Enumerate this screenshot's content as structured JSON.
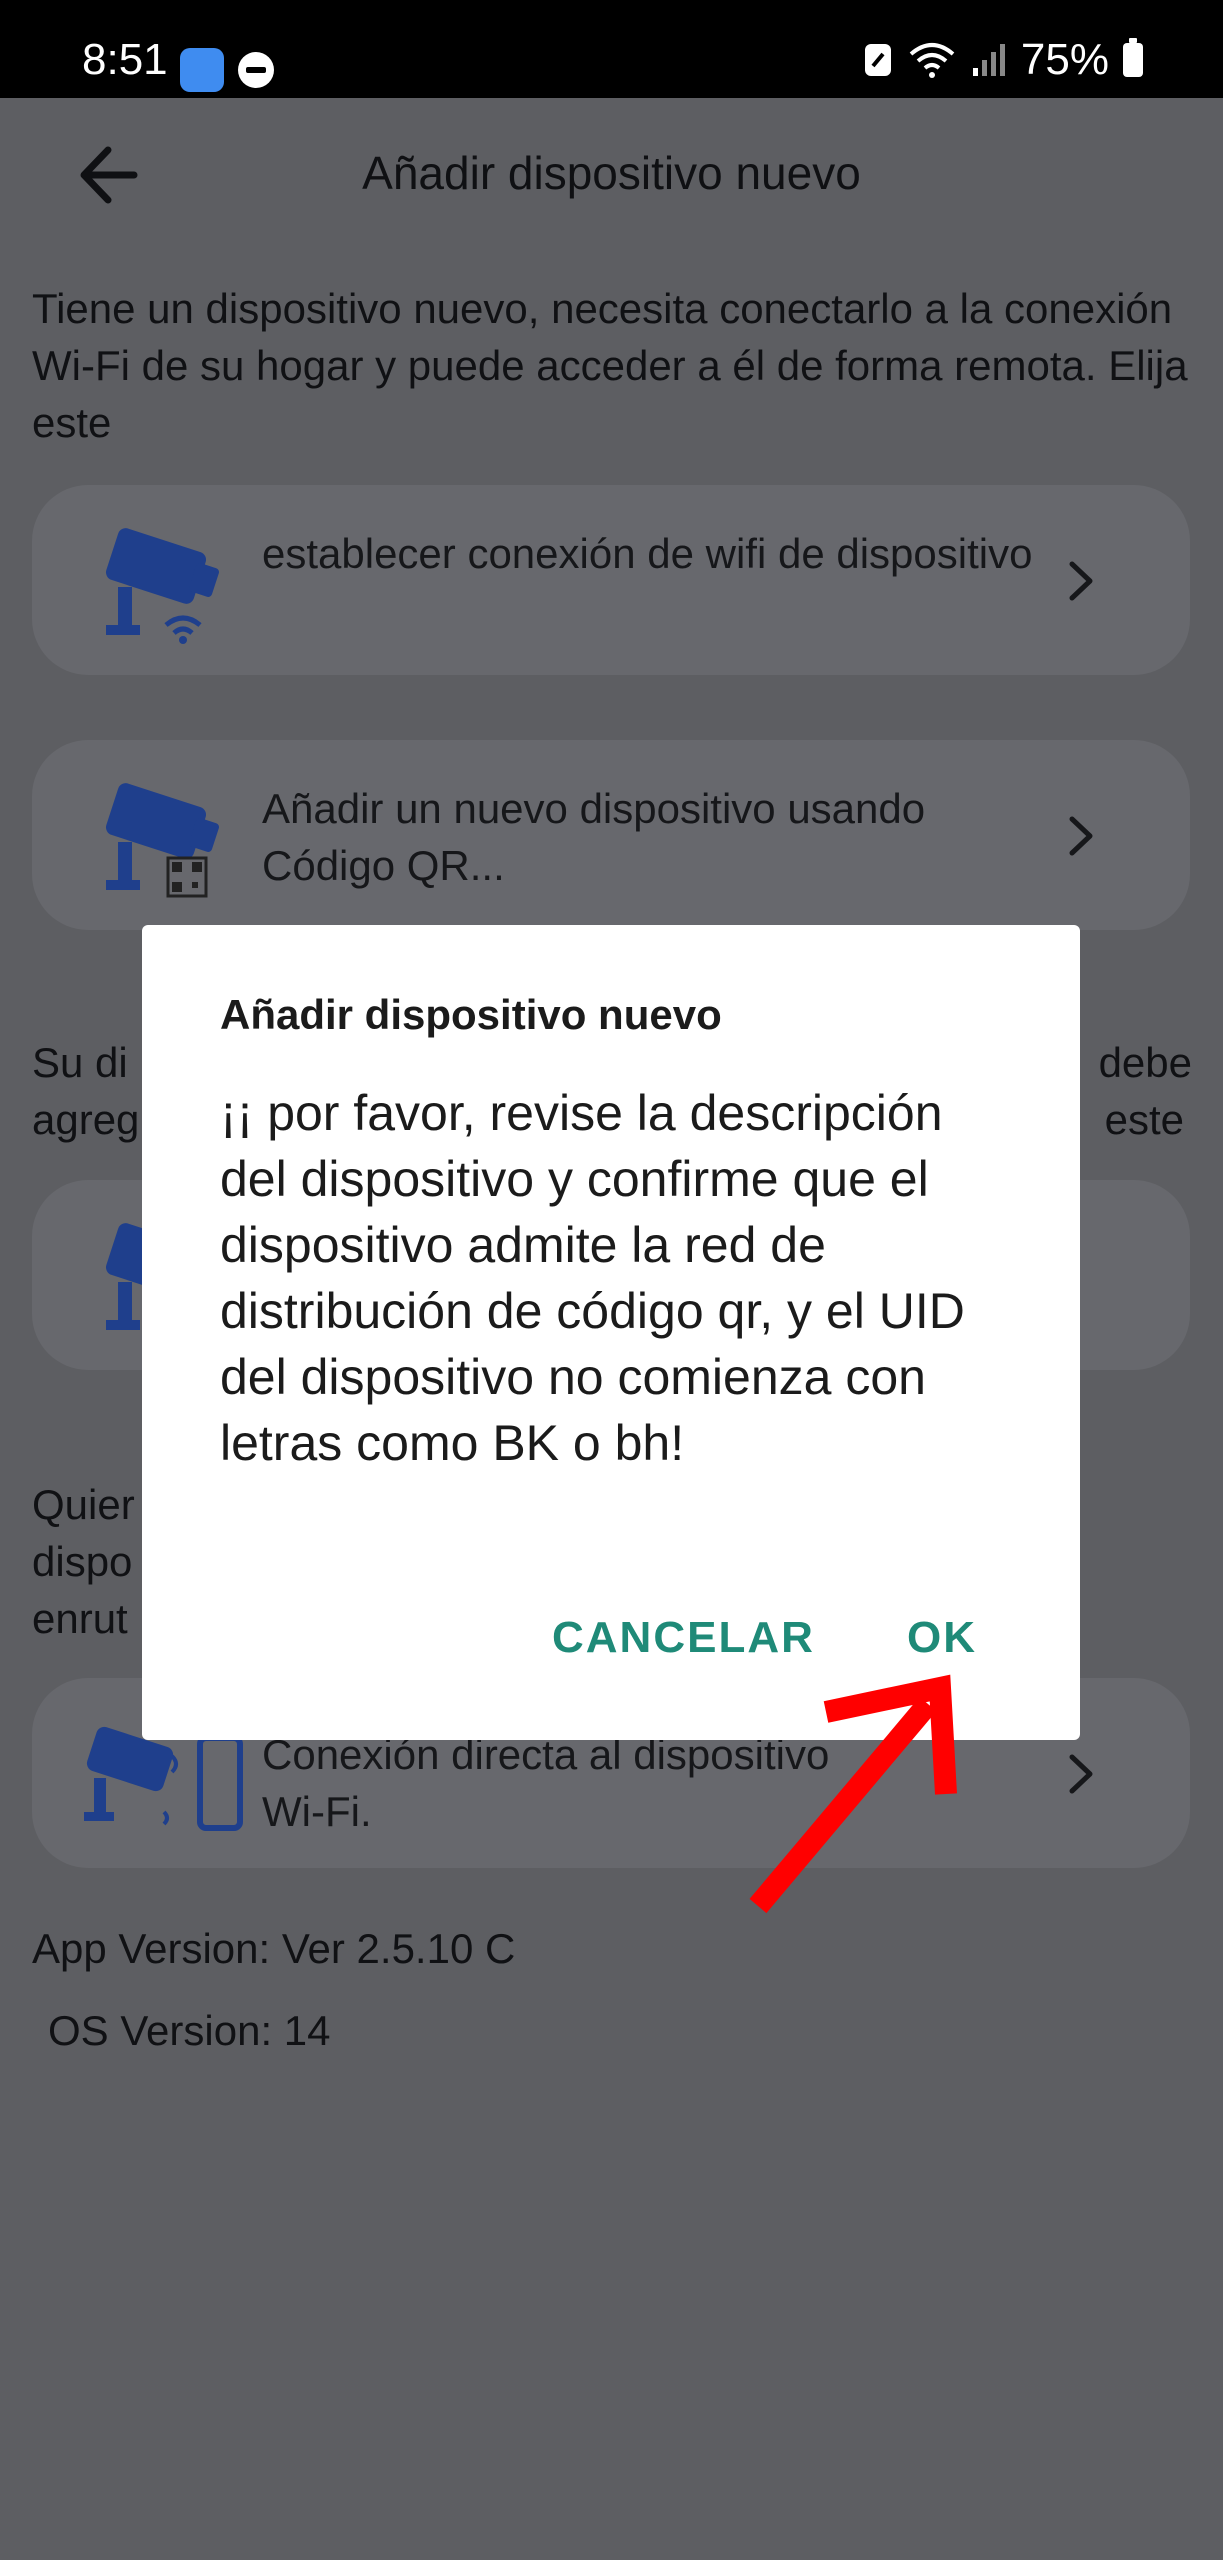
{
  "status_bar": {
    "time": "8:51",
    "battery": "75%"
  },
  "header": {
    "title": "Añadir dispositivo nuevo",
    "back_icon": "arrow-left-icon"
  },
  "intro_text": "Tiene un dispositivo nuevo, necesita conectarlo a la conexión Wi-Fi de su hogar y puede acceder a él de forma remota. Elija este",
  "options": [
    {
      "label": "establecer conexión de wifi de dispositivo",
      "icon": "camera-wifi-icon"
    },
    {
      "label": "Añadir un nuevo dispositivo usando Código QR...",
      "icon": "camera-qr-icon"
    }
  ],
  "partial_section_2": {
    "line1_left": "Su di",
    "line1_right": "debe",
    "line2_left": "agreg",
    "line2_right": "este"
  },
  "partial_section_3": {
    "line1": "Quier",
    "line2": "dispo",
    "line3": "enrut"
  },
  "direct_option": {
    "line1": "Conexión directa al dispositivo",
    "line2": "Wi-Fi."
  },
  "footer": {
    "app_version": "App Version: Ver 2.5.10 C",
    "os_version": "OS Version: 14"
  },
  "dialog": {
    "title": "Añadir dispositivo nuevo",
    "message": "¡¡ por favor, revise la descripción del dispositivo y confirme que el dispositivo admite la red de distribución de código qr, y el UID del dispositivo no comienza con letras como BK o bh!",
    "cancel_label": "CANCELAR",
    "ok_label": "OK"
  },
  "colors": {
    "dim_background": "#5d5e62",
    "card": "#67686d",
    "accent": "#1f8a78",
    "icon_blue": "#1f3f8c",
    "arrow_red": "#ff0000"
  }
}
